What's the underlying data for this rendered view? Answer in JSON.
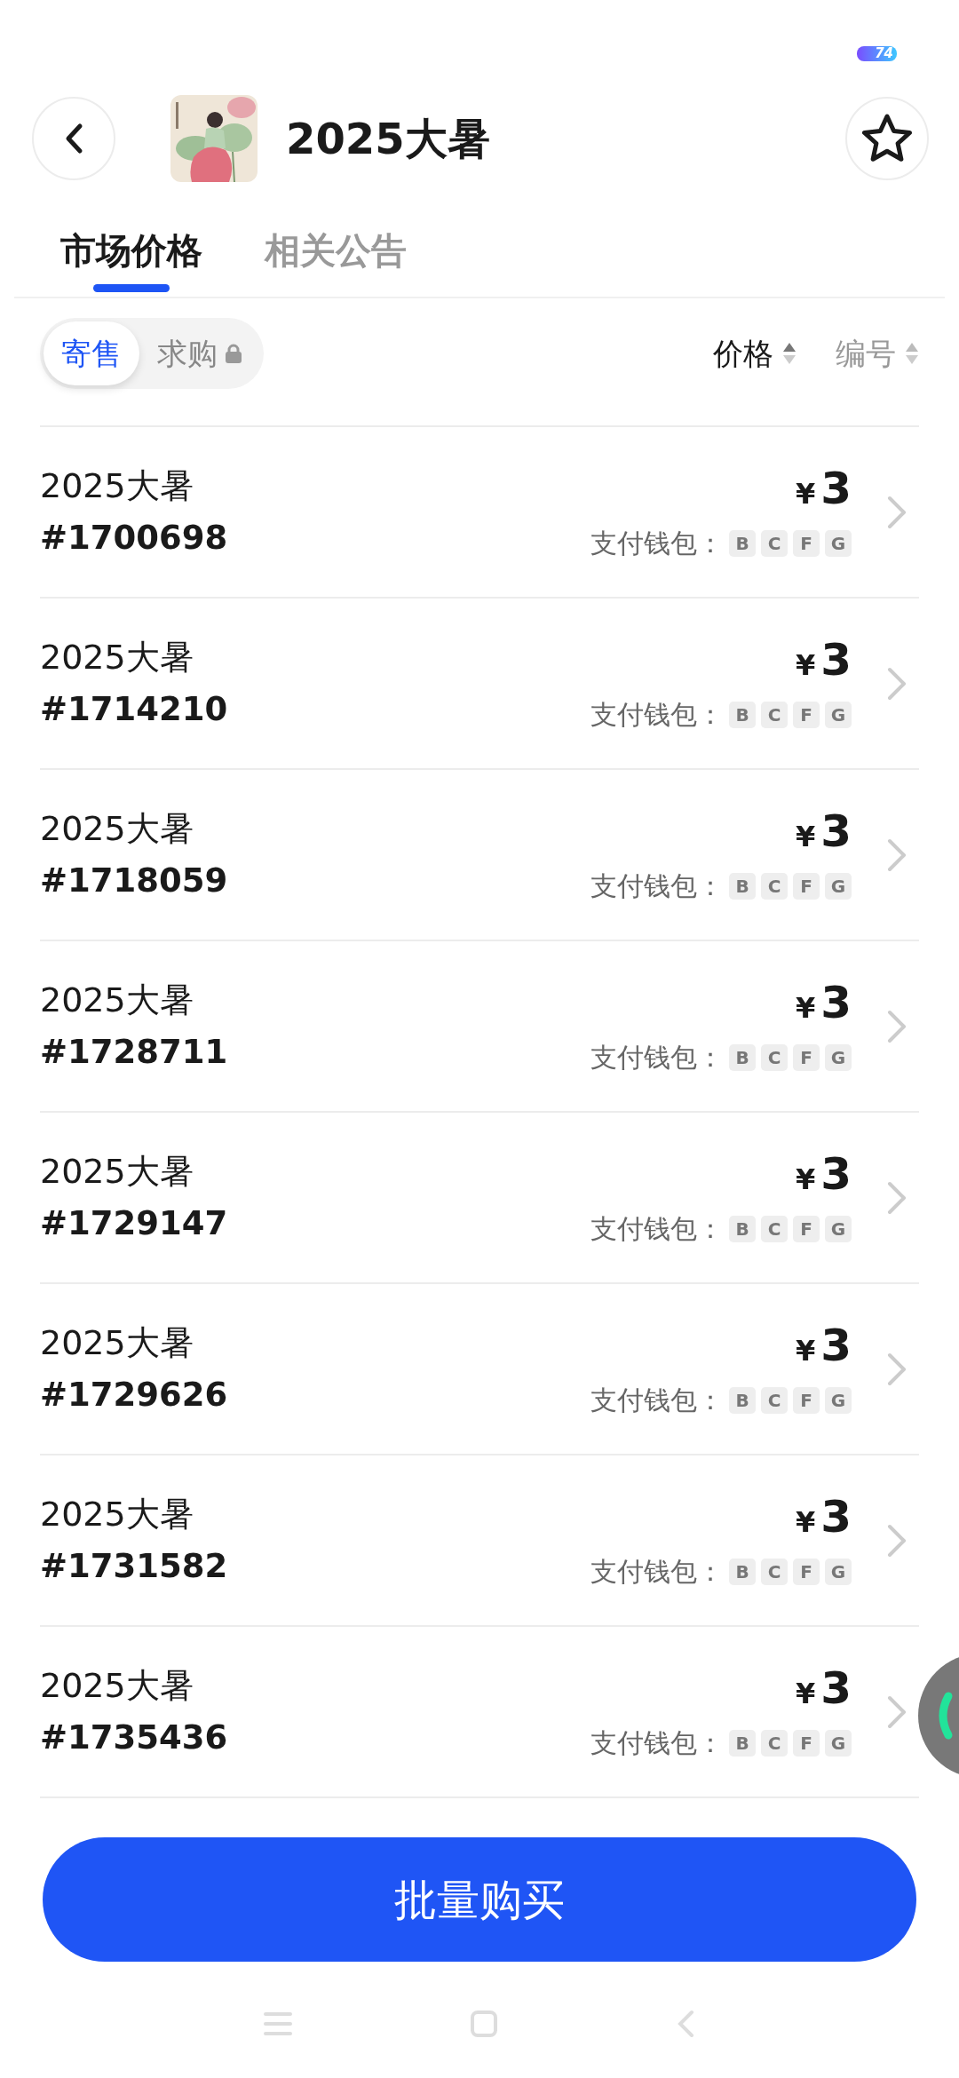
{
  "status_bar": {
    "battery": "74"
  },
  "header": {
    "title": "2025大暑"
  },
  "tabs": [
    {
      "label": "市场价格",
      "selected": true
    },
    {
      "label": "相关公告",
      "selected": false
    }
  ],
  "segments": [
    {
      "label": "寄售",
      "selected": true,
      "locked": false
    },
    {
      "label": "求购",
      "selected": false,
      "locked": true
    }
  ],
  "sort": [
    {
      "label": "价格",
      "selected": true
    },
    {
      "label": "编号",
      "selected": false
    }
  ],
  "listings": [
    {
      "name": "2025大暑",
      "number": "#1700698",
      "currency": "¥",
      "price": "3",
      "wallet_label": "支付钱包：",
      "wallets": [
        "B",
        "C",
        "F",
        "G"
      ]
    },
    {
      "name": "2025大暑",
      "number": "#1714210",
      "currency": "¥",
      "price": "3",
      "wallet_label": "支付钱包：",
      "wallets": [
        "B",
        "C",
        "F",
        "G"
      ]
    },
    {
      "name": "2025大暑",
      "number": "#1718059",
      "currency": "¥",
      "price": "3",
      "wallet_label": "支付钱包：",
      "wallets": [
        "B",
        "C",
        "F",
        "G"
      ]
    },
    {
      "name": "2025大暑",
      "number": "#1728711",
      "currency": "¥",
      "price": "3",
      "wallet_label": "支付钱包：",
      "wallets": [
        "B",
        "C",
        "F",
        "G"
      ]
    },
    {
      "name": "2025大暑",
      "number": "#1729147",
      "currency": "¥",
      "price": "3",
      "wallet_label": "支付钱包：",
      "wallets": [
        "B",
        "C",
        "F",
        "G"
      ]
    },
    {
      "name": "2025大暑",
      "number": "#1729626",
      "currency": "¥",
      "price": "3",
      "wallet_label": "支付钱包：",
      "wallets": [
        "B",
        "C",
        "F",
        "G"
      ]
    },
    {
      "name": "2025大暑",
      "number": "#1731582",
      "currency": "¥",
      "price": "3",
      "wallet_label": "支付钱包：",
      "wallets": [
        "B",
        "C",
        "F",
        "G"
      ]
    },
    {
      "name": "2025大暑",
      "number": "#1735436",
      "currency": "¥",
      "price": "3",
      "wallet_label": "支付钱包：",
      "wallets": [
        "B",
        "C",
        "F",
        "G"
      ]
    }
  ],
  "bulk_button": "批量购买"
}
